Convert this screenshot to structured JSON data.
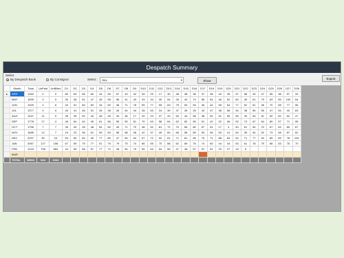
{
  "window": {
    "title": "Despatch Summary"
  },
  "toolbar": {
    "select_label": "Select",
    "radio_despatch": "By Despatch Book",
    "radio_consignor": "By Consignor",
    "select_colon": "Select :",
    "select_value": "ALL",
    "show_button": "Show",
    "export_button": "Export"
  },
  "grid": {
    "columns": [
      "Month",
      "Total",
      "UnPaid",
      "UnBilled",
      "D1",
      "D2",
      "D3",
      "D4",
      "D5",
      "D6",
      "D7",
      "D8",
      "D9",
      "D10",
      "D11",
      "D12",
      "D13",
      "D14",
      "D15",
      "D16",
      "D17",
      "D18",
      "D19",
      "D20",
      "D21",
      "D22",
      "D23",
      "D24",
      "D25",
      "D26",
      "D27",
      "D28"
    ],
    "rows": [
      [
        "APR",
        "1262",
        "0",
        "0",
        "80",
        "63",
        "56",
        "60",
        "44",
        "69",
        "67",
        "19",
        "32",
        "39",
        "29",
        "17",
        "30",
        "38",
        "38",
        "36",
        "37",
        "38",
        "40",
        "39",
        "37",
        "58",
        "33",
        "47",
        "55",
        "38",
        "57",
        "33"
      ],
      [
        "MAY",
        "1599",
        "0",
        "0",
        "30",
        "35",
        "51",
        "47",
        "45",
        "55",
        "56",
        "41",
        "43",
        "43",
        "34",
        "30",
        "54",
        "26",
        "42",
        "74",
        "56",
        "64",
        "46",
        "52",
        "60",
        "45",
        "61",
        "79",
        "63",
        "55",
        "100",
        "64"
      ],
      [
        "JUN",
        "1929",
        "2",
        "6",
        "40",
        "51",
        "84",
        "60",
        "44",
        "60",
        "46",
        "71",
        "78",
        "59",
        "77",
        "55",
        "63",
        "75",
        "63",
        "54",
        "46",
        "44",
        "55",
        "64",
        "77",
        "52",
        "61",
        "48",
        "70",
        "58",
        "77",
        "56"
      ],
      [
        "JUL",
        "1377",
        "0",
        "0",
        "49",
        "41",
        "46",
        "51",
        "26",
        "28",
        "26",
        "44",
        "44",
        "28",
        "53",
        "24",
        "39",
        "37",
        "26",
        "25",
        "43",
        "47",
        "38",
        "56",
        "34",
        "38",
        "55",
        "55",
        "47",
        "54",
        "42",
        "63"
      ],
      [
        "AUG",
        "1437",
        "11",
        "0",
        "35",
        "35",
        "52",
        "40",
        "48",
        "45",
        "43",
        "36",
        "17",
        "20",
        "24",
        "37",
        "43",
        "50",
        "44",
        "58",
        "38",
        "52",
        "51",
        "55",
        "55",
        "49",
        "63",
        "51",
        "52",
        "62",
        "62",
        "47"
      ],
      [
        "SEP",
        "1778",
        "17",
        "4",
        "46",
        "64",
        "40",
        "49",
        "61",
        "56",
        "55",
        "59",
        "61",
        "70",
        "63",
        "58",
        "64",
        "62",
        "60",
        "55",
        "51",
        "42",
        "22",
        "46",
        "92",
        "74",
        "67",
        "64",
        "89",
        "57",
        "71",
        "95"
      ],
      [
        "OCT",
        "1756",
        "7",
        "7",
        "35",
        "40",
        "26",
        "48",
        "54",
        "50",
        "49",
        "71",
        "70",
        "48",
        "52",
        "81",
        "72",
        "70",
        "65",
        "80",
        "67",
        "51",
        "17",
        "4",
        "40",
        "61",
        "54",
        "70",
        "67",
        "63",
        "80",
        "67"
      ],
      [
        "NOV",
        "1685",
        "12",
        "7",
        "19",
        "23",
        "36",
        "61",
        "59",
        "63",
        "58",
        "58",
        "28",
        "42",
        "37",
        "49",
        "60",
        "66",
        "58",
        "55",
        "53",
        "46",
        "53",
        "41",
        "54",
        "35",
        "54",
        "52",
        "73",
        "58",
        "87",
        "62"
      ],
      [
        "DEC",
        "2297",
        "30",
        "24",
        "53",
        "60",
        "60",
        "40",
        "77",
        "80",
        "47",
        "54",
        "54",
        "67",
        "72",
        "92",
        "61",
        "71",
        "81",
        "55",
        "75",
        "71",
        "88",
        "84",
        "52",
        "71",
        "77",
        "94",
        "89",
        "69",
        "78",
        "104"
      ],
      [
        "JAN",
        "2067",
        "127",
        "156",
        "67",
        "59",
        "79",
        "77",
        "51",
        "79",
        "79",
        "75",
        "74",
        "66",
        "55",
        "70",
        "88",
        "62",
        "89",
        "75",
        "74",
        "60",
        "44",
        "44",
        "53",
        "61",
        "78",
        "79",
        "68",
        "53",
        "76",
        "70"
      ],
      [
        "FEB",
        "1223",
        "738",
        "852",
        "44",
        "55",
        "68",
        "57",
        "77",
        "72",
        "48",
        "54",
        "79",
        "55",
        "63",
        "54",
        "55",
        "47",
        "46",
        "57",
        "57",
        "51",
        "23",
        "27",
        "19",
        "9",
        "",
        "",
        "",
        "",
        "",
        ""
      ],
      [
        "MAR",
        "",
        "",
        "",
        "",
        "",
        "",
        "",
        "",
        "",
        "",
        "",
        "",
        "",
        "",
        "",
        "",
        "",
        "",
        "",
        "",
        "",
        "",
        "",
        "",
        "",
        "",
        "",
        "",
        "",
        "",
        ""
      ]
    ],
    "total": [
      "TOTAL",
      "18510",
      "944",
      "1041",
      "",
      "",
      "",
      "",
      "",
      "",
      "",
      "",
      "",
      "",
      "",
      "",
      "",
      "",
      "",
      "",
      "",
      "",
      "",
      "",
      "",
      "",
      "",
      "",
      "",
      "",
      "",
      ""
    ],
    "selected_month": "APR",
    "orange_column": "D17",
    "highlight_row": "MAR"
  },
  "colors": {
    "titlebar": "#2b3745",
    "selection": "#1e72d0",
    "orange_cell": "#d8652a",
    "highlight_row": "#fbe9c3"
  }
}
